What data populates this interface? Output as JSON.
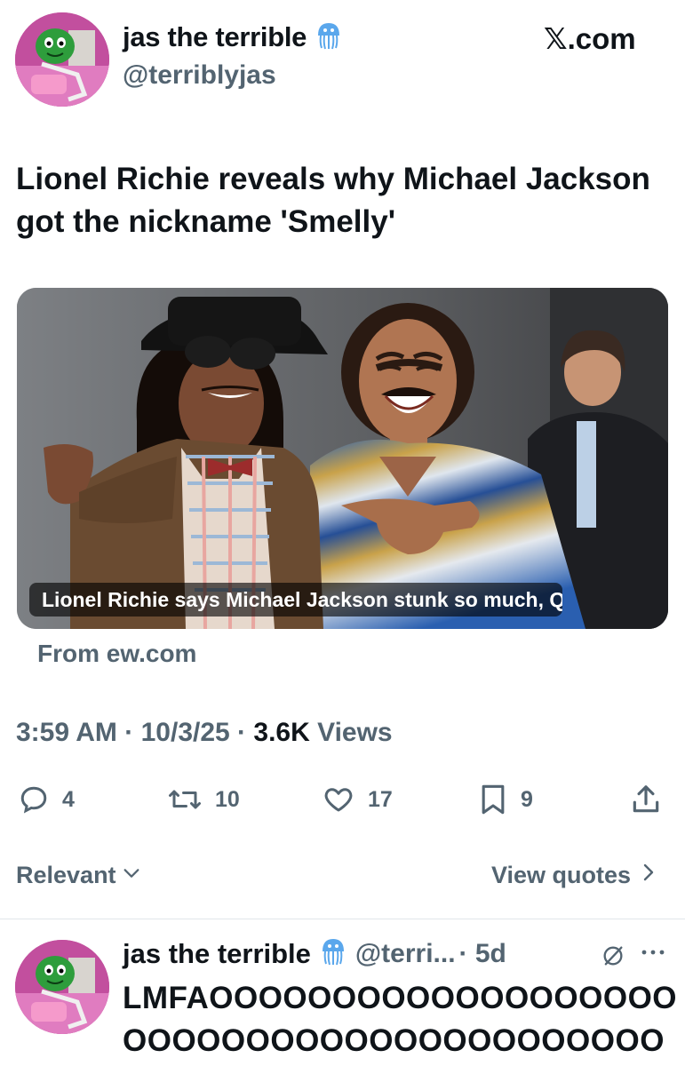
{
  "tweet": {
    "author_name": "jas the terrible",
    "author_handle": "@terriblyjas",
    "badge_icon": "jellyfish-emoji-icon",
    "site_label": "𝕏.com",
    "text": "Lionel Richie reveals why Michael Jackson got the nickname 'Smelly'",
    "card": {
      "caption": "Lionel Richie says Michael Jackson stunk so much, Qui...",
      "source": "From ew.com"
    },
    "time": "3:59 AM",
    "date": "10/3/25",
    "views_count": "3.6K",
    "views_label": "Views",
    "separator": "·",
    "actions": {
      "replies": "4",
      "reposts": "10",
      "likes": "17",
      "bookmarks": "9"
    }
  },
  "sort": {
    "relevant_label": "Relevant",
    "view_quotes_label": "View quotes"
  },
  "reply": {
    "author_name": "jas the terrible",
    "author_handle": "@terri...",
    "time": "· 5d",
    "text": "LMFAOOOOOOOOOOOOOOOOOOOOOOOOOOOOOOOOOOOOOOOOOOOOOOO"
  },
  "colors": {
    "text_primary": "#0f1419",
    "text_secondary": "#536471",
    "divider": "#e1e6ea",
    "avatar_bg": "#c24f9e"
  }
}
